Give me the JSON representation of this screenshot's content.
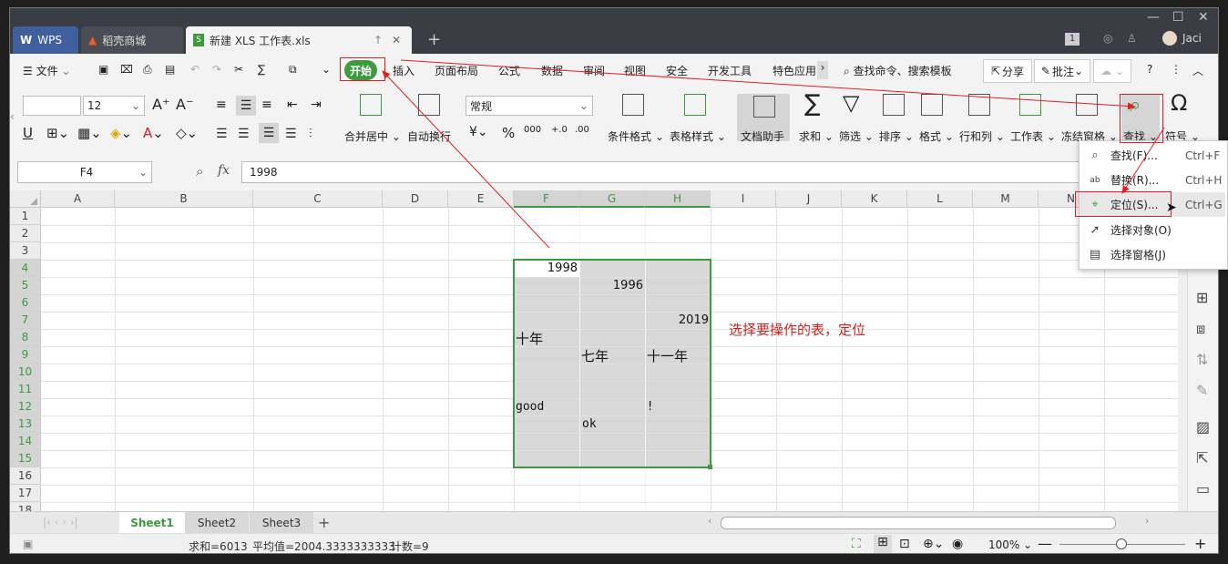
{
  "tabs": {
    "wps": "WPS",
    "store": "稻壳商城",
    "file": "新建 XLS 工作表.xls",
    "user": "Jaci"
  },
  "menu": {
    "file": "文件",
    "items": [
      "开始",
      "插入",
      "页面布局",
      "公式",
      "数据",
      "审阅",
      "视图",
      "安全",
      "开发工具",
      "特色应用"
    ],
    "search": "查找命令、搜索模板",
    "share": "分享",
    "comment": "批注"
  },
  "ribbon": {
    "font_size": "12",
    "number_format": "常规",
    "merge": "合并居中",
    "wrap": "自动换行",
    "cond_format": "条件格式",
    "table_style": "表格样式",
    "doc_helper": "文档助手",
    "sum": "求和",
    "filter": "筛选",
    "sort": "排序",
    "format": "格式",
    "rowcol": "行和列",
    "worksheet": "工作表",
    "freeze": "冻结窗格",
    "find": "查找",
    "symbol": "符号"
  },
  "formula": {
    "cell_ref": "F4",
    "fx": "fx",
    "value": "1998"
  },
  "columns": [
    "A",
    "B",
    "C",
    "D",
    "E",
    "F",
    "G",
    "H",
    "I",
    "J",
    "K",
    "L",
    "M",
    "N"
  ],
  "rows": [
    "1",
    "2",
    "3",
    "4",
    "5",
    "6",
    "7",
    "8",
    "9",
    "10",
    "11",
    "12",
    "13",
    "14",
    "15",
    "16",
    "17",
    "18"
  ],
  "cells": {
    "f4": "1998",
    "g5": "1996",
    "h7": "2019",
    "f8": "十年",
    "g9": "七年",
    "h9": "十一年",
    "f12": "good",
    "h12": "!",
    "g13": "ok"
  },
  "annotation": "选择要操作的表，定位",
  "dropdown": [
    {
      "label": "查找(F)...",
      "key": "Ctrl+F",
      "icon": "magnifier-icon"
    },
    {
      "label": "替换(R)...",
      "key": "Ctrl+H",
      "icon": "replace-icon"
    },
    {
      "label": "定位(S)...",
      "key": "Ctrl+G",
      "icon": "locate-icon"
    },
    {
      "label": "选择对象(O)",
      "key": "",
      "icon": "cursor-icon"
    },
    {
      "label": "选择窗格(J)",
      "key": "",
      "icon": "pane-icon"
    }
  ],
  "sheets": [
    "Sheet1",
    "Sheet2",
    "Sheet3"
  ],
  "status": {
    "sum": "求和=6013",
    "avg": "平均值=2004.3333333333",
    "count": "计数=9",
    "zoom": "100%"
  },
  "colors": {
    "accent_green": "#3e9a3e",
    "annotation_red": "#e02020",
    "selection_fill": "#d8d8d8"
  }
}
